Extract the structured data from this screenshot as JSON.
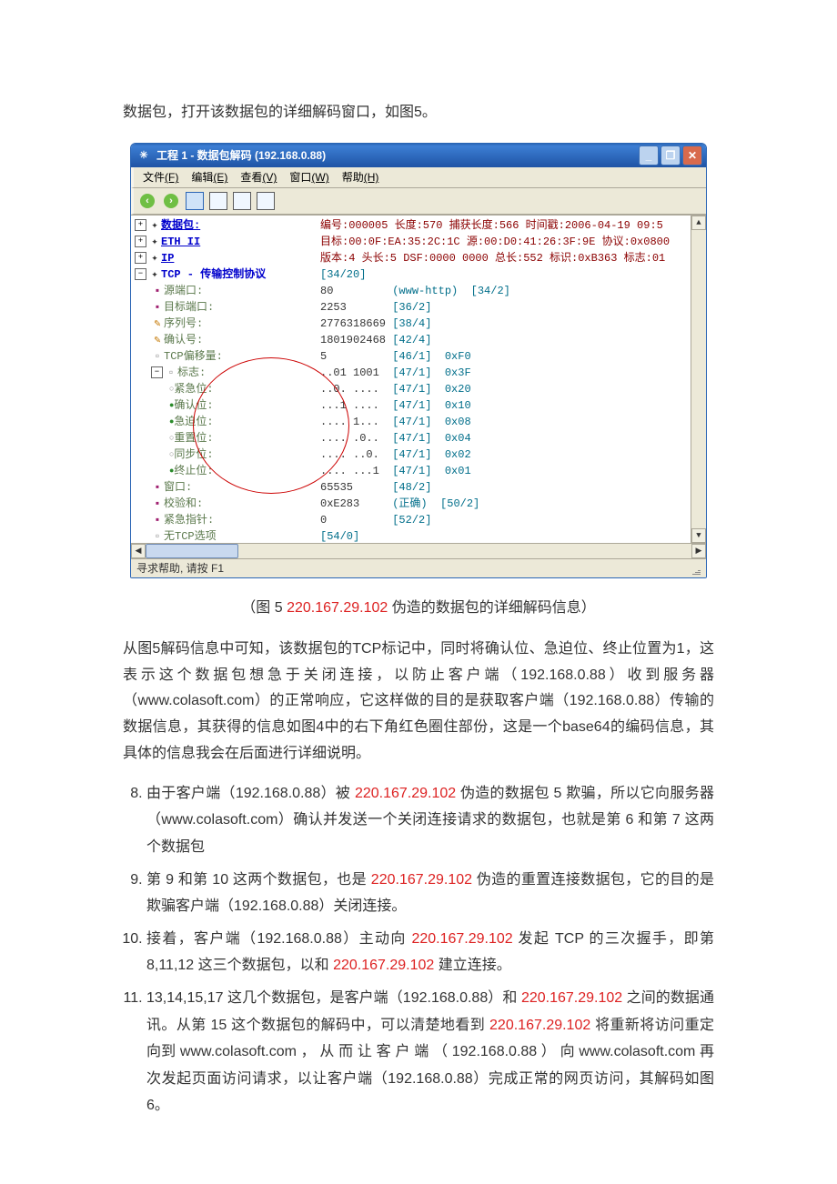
{
  "document": {
    "intro_para": "数据包，打开该数据包的详细解码窗口，如图5。",
    "caption_prefix": "（图 5   ",
    "caption_ip": "220.167.29.102",
    "caption_suffix": " 伪造的数据包的详细解码信息）",
    "para2": "从图5解码信息中可知，该数据包的TCP标记中，同时将确认位、急迫位、终止位置为1，这表示这个数据包想急于关闭连接，以防止客户端（192.168.0.88）收到服务器（www.colasoft.com）的正常响应，它这样做的目的是获取客户端（192.168.0.88）传输的数据信息，其获得的信息如图4中的右下角红色圈住部份，这是一个base64的编码信息，其具体的信息我会在后面进行详细说明。",
    "list": {
      "8": {
        "pre": "由于客户端（192.168.0.88）被 ",
        "ip": "220.167.29.102",
        "post": " 伪造的数据包 5 欺骗，所以它向服务器（www.colasoft.com）确认并发送一个关闭连接请求的数据包，也就是第 6 和第 7 这两个数据包"
      },
      "9": {
        "pre": "第 9 和第 10 这两个数据包，也是 ",
        "ip": "220.167.29.102",
        "post": " 伪造的重置连接数据包，它的目的是欺骗客户端（192.168.0.88）关闭连接。"
      },
      "10": {
        "pre": "接着，客户端（192.168.0.88）主动向 ",
        "ip1": "220.167.29.102",
        "mid": " 发起 TCP 的三次握手，即第 8,11,12 这三个数据包，以和 ",
        "ip2": "220.167.29.102",
        "post": " 建立连接。"
      },
      "11": {
        "pre": "13,14,15,17 这几个数据包，是客户端（192.168.0.88）和 ",
        "ip1": "220.167.29.102",
        "mid1": " 之间的数据通讯。从第 15 这个数据包的解码中，可以清楚地看到 ",
        "ip2": "220.167.29.102",
        "mid2": " 将重新将访问重定向到 www.colasoft.com ， 从 而 让 客 户 端 （ 192.168.0.88 ） 向 www.colasoft.com 再次发起页面访问请求，以让客户端（192.168.0.88）完成正常的网页访问，其解码如图 6。"
      }
    }
  },
  "app": {
    "title": "工程 1 - 数据包解码 (192.168.0.88)",
    "minimize": "_",
    "restore": "❐",
    "close": "✕",
    "menu": {
      "file": "文件",
      "file_k": "(F)",
      "edit": "编辑",
      "edit_k": "(E)",
      "view": "查看",
      "view_k": "(V)",
      "window": "窗口",
      "window_k": "(W)",
      "help": "帮助",
      "help_k": "(H)"
    },
    "status": "寻求帮助, 请按 F1",
    "tree": {
      "packet": "数据包:",
      "packet_detail_pre": "编号:000005 长度:570 捕获长度:566 时间戳:2006-04-19 09:5",
      "eth": "ETH II",
      "eth_detail": "目标:00:0F:EA:35:2C:1C 源:00:D0:41:26:3F:9E 协议:0x0800",
      "ip": "IP",
      "ip_detail": "版本:4 头长:5 DSF:0000 0000 总长:552 标识:0xB363 标志:01",
      "tcp": "TCP - 传输控制协议",
      "tcp_off": "[34/20]",
      "srcport": "源端口:",
      "srcport_v": "80",
      "srcport_note": "(www-http)  [34/2]",
      "dstport": "目标端口:",
      "dstport_v": "2253",
      "dstport_off": "[36/2]",
      "seq": "序列号:",
      "seq_v": "2776318669",
      "seq_off": "[38/4]",
      "ack": "确认号:",
      "ack_v": "1801902468",
      "ack_off": "[42/4]",
      "hdrlen": "TCP偏移量:",
      "hdrlen_v": "5",
      "hdrlen_off": "[46/1]",
      "hdrlen_hex": "0xF0",
      "flags": "标志:",
      "flags_v": "..01 1001",
      "flags_off": "[47/1]",
      "flags_hex": "0x3F",
      "urg": "紧急位:",
      "urg_v": "..0. ....",
      "urg_hex": "0x20",
      "ackb": "确认位:",
      "ackb_v": "...1 ....",
      "ackb_hex": "0x10",
      "psh": "急迫位:",
      "psh_v": ".... 1...",
      "psh_hex": "0x08",
      "rst": "重置位:",
      "rst_v": ".... .0..",
      "rst_hex": "0x04",
      "syn": "同步位:",
      "syn_v": ".... ..0.",
      "syn_hex": "0x02",
      "fin": "终止位:",
      "fin_v": ".... ...1",
      "fin_hex": "0x01",
      "win": "窗口:",
      "win_v": "65535",
      "win_off": "[48/2]",
      "chk": "校验和:",
      "chk_v": "0xE283",
      "chk_note": "(正确)  [50/2]",
      "urp": "紧急指针:",
      "urp_v": "0",
      "urp_off": "[52/2]",
      "opt": "无TCP选项",
      "opt_off": "[54/0]"
    }
  }
}
